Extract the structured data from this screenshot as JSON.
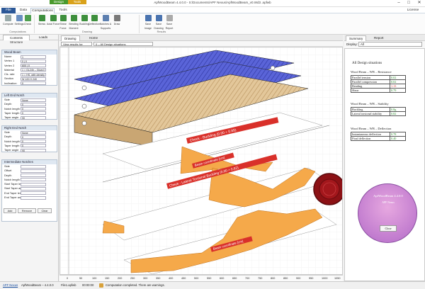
{
  "titlebar": {
    "title": "ApfWoodBeam 4.4.0.0 - S:\\Documents\\APF Nexus\\ApfWoodBeam_v0.Wd3 .apfwb",
    "contexts": [
      {
        "label": "Design",
        "color": "#4a9a2e"
      },
      {
        "label": "Tools",
        "color": "#d9a21b"
      }
    ],
    "win_buttons": [
      "–",
      "□",
      "✕"
    ]
  },
  "tabs": {
    "items": [
      "File",
      "Data",
      "Computations",
      "Tools"
    ],
    "active": "Computations",
    "license": "License"
  },
  "ribbon": {
    "buttons": [
      {
        "label": "Compute",
        "icon": "compute-icon",
        "color": "#9aa"
      },
      {
        "label": "Settings",
        "icon": "settings-icon",
        "color": "#6a8fc1"
      },
      {
        "label": "Check",
        "icon": "check-icon",
        "color": "#4f9f4f"
      },
      {
        "label": "Stress",
        "icon": "stress-icon",
        "color": "#3d8f3d"
      },
      {
        "label": "Axial Force",
        "icon": "axial-force-icon",
        "color": "#3d8f3d"
      },
      {
        "label": "Shear Force",
        "icon": "shear-force-icon",
        "color": "#3d8f3d"
      },
      {
        "label": "Bending Moment",
        "icon": "bending-moment-icon",
        "color": "#3d8f3d"
      },
      {
        "label": "Buckling",
        "icon": "buckling-icon",
        "color": "#3d8f3d"
      },
      {
        "label": "Deflection",
        "icon": "deflection-icon",
        "color": "#3d8f3d"
      },
      {
        "label": "Notches & Supports",
        "icon": "notches-icon",
        "color": "#5c7fb0"
      },
      {
        "label": "Draw",
        "icon": "draw-icon",
        "color": "#7a7a7a"
      },
      {
        "label": "Save Image",
        "icon": "save-image-icon",
        "color": "#4a74b0"
      },
      {
        "label": "Save Drawing",
        "icon": "save-drawing-icon",
        "color": "#4a74b0"
      },
      {
        "label": "Save Report",
        "icon": "save-report-icon",
        "color": "#aaa"
      }
    ],
    "groups": [
      "Computations",
      "Drawing",
      "Results"
    ]
  },
  "left": {
    "tabs": [
      "Contents",
      "Loads"
    ],
    "header": "Structure",
    "wood_beam": {
      "title": "Wood Beam",
      "rows": [
        {
          "label": "Name",
          "value": "1"
        },
        {
          "label": "Vertex 1",
          "value": "0   |  0"
        },
        {
          "label": "Vertex 2",
          "value": "600  |  0"
        },
        {
          "label": "Material",
          "value": "1 = GL24h – Glued l"
        },
        {
          "label": "Cls. rate",
          "value": "1 = HS, with density"
        },
        {
          "label": "Section",
          "value": "W 120   H 240"
        },
        {
          "label": "Inclination",
          "value": "0"
        }
      ]
    },
    "left_end": {
      "title": "Left End Notch",
      "rows": [
        {
          "label": "Side",
          "value": "None"
        },
        {
          "label": "Depth",
          "value": "0"
        },
        {
          "label": "Notch length",
          "value": "0"
        },
        {
          "label": "Taper length",
          "value": "0"
        },
        {
          "label": "Taper angle",
          "value": "90"
        }
      ]
    },
    "right_end": {
      "title": "Right End Notch",
      "rows": [
        {
          "label": "Side",
          "value": "None"
        },
        {
          "label": "Depth",
          "value": "0"
        },
        {
          "label": "Notch length",
          "value": "0"
        },
        {
          "label": "Taper length",
          "value": "0"
        },
        {
          "label": "Taper angle",
          "value": "90"
        }
      ]
    },
    "intermediate": {
      "title": "Intermediate Notches",
      "rows": [
        {
          "label": "Side",
          "value": ""
        },
        {
          "label": "Offset",
          "value": ""
        },
        {
          "label": "Depth",
          "value": ""
        },
        {
          "label": "Notch length",
          "value": ""
        },
        {
          "label": "Start Taper length",
          "value": ""
        },
        {
          "label": "Start Taper angle",
          "value": ""
        },
        {
          "label": "End Taper length",
          "value": ""
        },
        {
          "label": "End Taper angle",
          "value": ""
        }
      ]
    },
    "buttons": [
      "Add",
      "Remove",
      "Clear"
    ]
  },
  "doc": {
    "tabs": [
      "Drawing",
      "Home"
    ],
    "viewbar": {
      "label": "View results for:",
      "sel1": "0 – All Design situations"
    },
    "chart_labels": {
      "buckling": "Check - Buckling (0.00 ÷ 0.89)",
      "lateral": "Check - Lateral Torsional Buckling (0.00 ÷ 0.82)",
      "beam_coord": "Beam coordinate [cm]"
    },
    "x_ticks": [
      "0",
      "50",
      "100",
      "150",
      "200",
      "250",
      "300",
      "350",
      "400",
      "450",
      "500",
      "550",
      "600",
      "650",
      "700",
      "750",
      "800",
      "850",
      "900",
      "950",
      "1000",
      "1050"
    ]
  },
  "right": {
    "tabs": [
      "Summary",
      "Report"
    ],
    "display_label": "Display:",
    "display_value": "All",
    "report": {
      "heading": "All Design situations",
      "t1": {
        "title": "Wood Beam – WB – Resistance",
        "rows": [
          [
            "Parallel tension",
            "0.02"
          ],
          [
            "Parallel compression",
            "0.02"
          ],
          [
            "Bending",
            "1.13"
          ],
          [
            "Shear",
            "0.79"
          ]
        ]
      },
      "t2": {
        "title": "Wood Beam – WB – Stability",
        "rows": [
          [
            "Buckling",
            "0.8g"
          ],
          [
            "Lateral torsional stability",
            "0.82"
          ]
        ]
      },
      "t3": {
        "title": "Wood Beam – WB – Deflection",
        "rows": [
          [
            "Instantaneous deflection",
            "0.78"
          ],
          [
            "Final deflection",
            "0.40"
          ]
        ]
      }
    },
    "seal": {
      "badge": "ApfWoodBeam 4.4.0.0",
      "line1": "APF Nexus",
      "close": "Close"
    }
  },
  "status": {
    "link": "APF Nexus",
    "ver": "ApfWoodBeam – 4.4.0.0",
    "file": "File1.apfwb",
    "time": "00:00:00",
    "message": "Computation completed. There are warnings."
  },
  "colors": {
    "accent": "#2e5c9a",
    "hatch_blue": "#4d58c9",
    "beam_tan": "#d8b98a",
    "check_fill": "#f5a94a",
    "label_red": "#d9302a",
    "warn": "#d8a13a",
    "seal": "#8c1115"
  }
}
